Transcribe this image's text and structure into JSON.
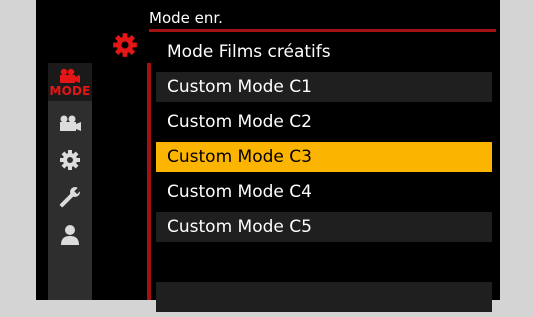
{
  "header": {
    "title": "Mode enr."
  },
  "tabs": [
    {
      "id": "mode",
      "label": "MODE",
      "icon": "movie-camera-icon",
      "active": true
    },
    {
      "id": "video",
      "icon": "video-camera-icon"
    },
    {
      "id": "custom",
      "icon": "gear-icon"
    },
    {
      "id": "setup",
      "icon": "wrench-icon"
    },
    {
      "id": "mymenu",
      "icon": "person-icon"
    }
  ],
  "submenu_icon": "gear-icon",
  "menu": {
    "items": [
      {
        "label": "Mode Films créatifs",
        "state": "plain"
      },
      {
        "label": "Custom Mode C1",
        "state": "normal"
      },
      {
        "label": "Custom Mode C2",
        "state": "plain"
      },
      {
        "label": "Custom Mode C3",
        "state": "selected"
      },
      {
        "label": "Custom Mode C4",
        "state": "plain"
      },
      {
        "label": "Custom Mode C5",
        "state": "normal"
      },
      {
        "label": "",
        "state": "plain"
      },
      {
        "label": "",
        "state": "normal"
      }
    ]
  },
  "colors": {
    "accent": "#e51616",
    "selection": "#fbb400",
    "divider": "#a31212"
  }
}
